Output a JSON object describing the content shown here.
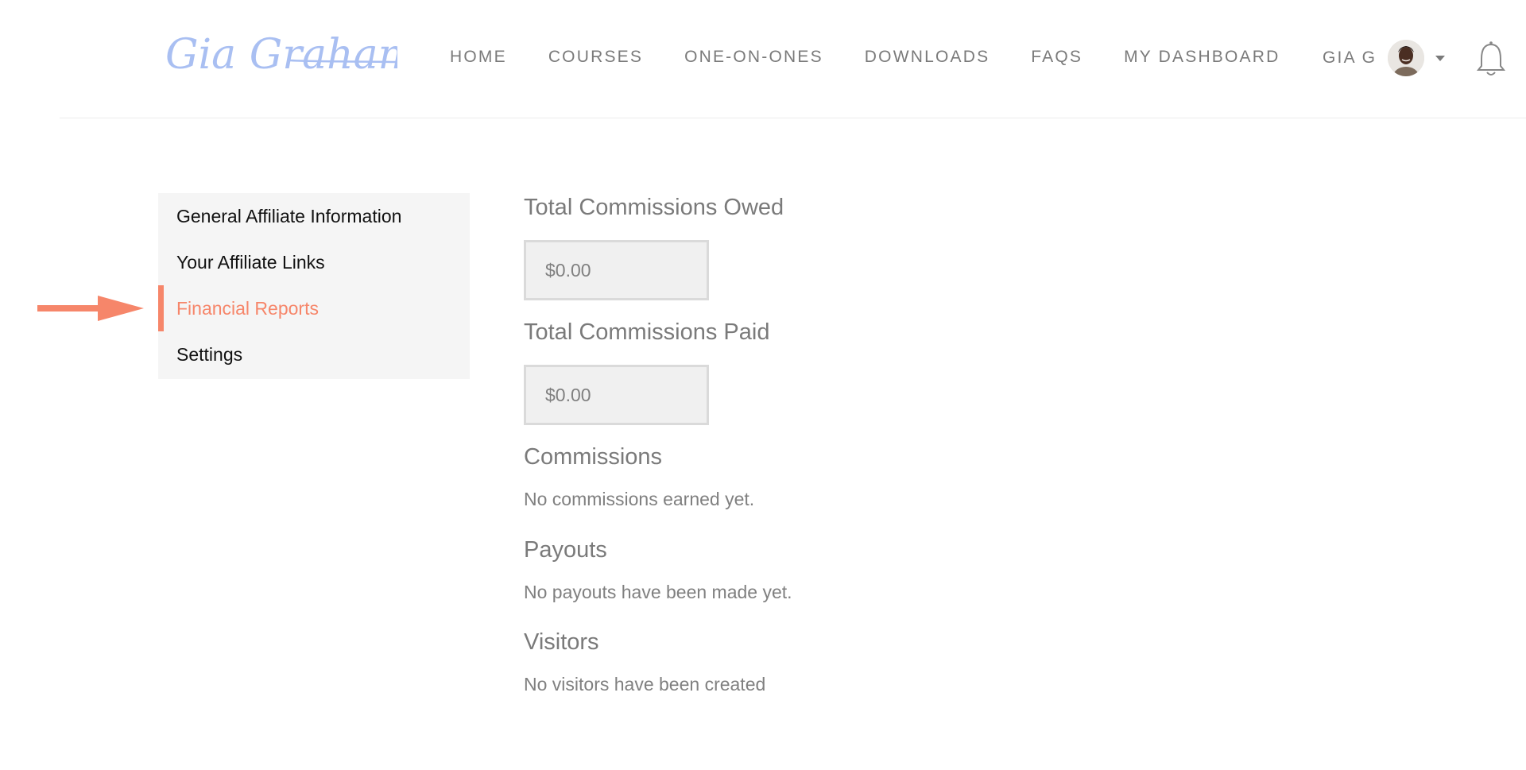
{
  "header": {
    "logo_text": "Gia Graham",
    "logo_color": "#a9bff2",
    "nav": [
      {
        "label": "HOME"
      },
      {
        "label": "COURSES"
      },
      {
        "label": "ONE-ON-ONES"
      },
      {
        "label": "DOWNLOADS"
      },
      {
        "label": "FAQS"
      },
      {
        "label": "MY DASHBOARD"
      }
    ],
    "user": {
      "name": "GIA G",
      "avatar_icon": "user-avatar",
      "menu_icon": "caret-down-icon"
    },
    "notifications_icon": "bell-icon"
  },
  "sidebar": {
    "accent_color": "#f6866a",
    "items": [
      {
        "label": "General Affiliate Information",
        "active": false
      },
      {
        "label": "Your Affiliate Links",
        "active": false
      },
      {
        "label": "Financial Reports",
        "active": true
      },
      {
        "label": "Settings",
        "active": false
      }
    ],
    "pointer_icon": "arrow-right-icon"
  },
  "main": {
    "owed": {
      "heading": "Total Commissions Owed",
      "value": "$0.00"
    },
    "paid": {
      "heading": "Total Commissions Paid",
      "value": "$0.00"
    },
    "commissions": {
      "heading": "Commissions",
      "text": "No commissions earned yet."
    },
    "payouts": {
      "heading": "Payouts",
      "text": "No payouts have been made yet."
    },
    "visitors": {
      "heading": "Visitors",
      "text": "No visitors have been created"
    }
  }
}
